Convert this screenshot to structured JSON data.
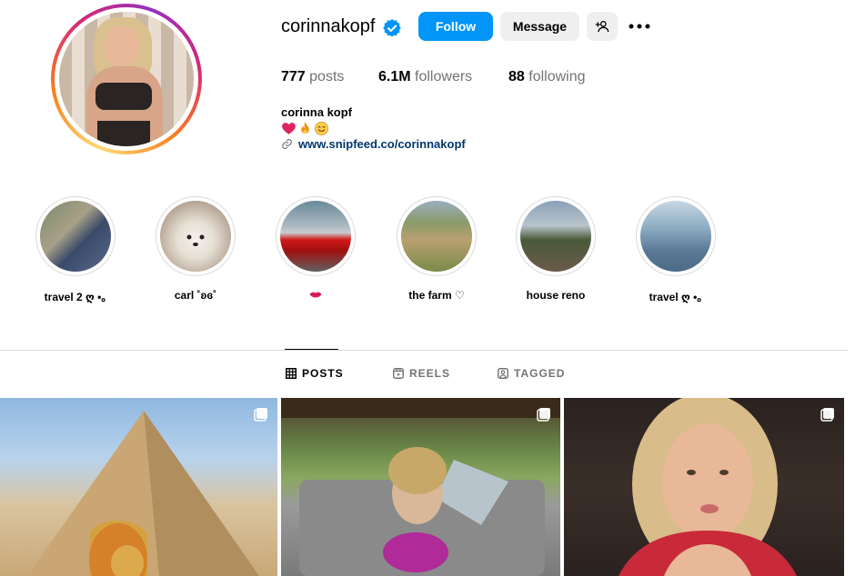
{
  "profile": {
    "username": "corinnakopf",
    "follow_label": "Follow",
    "message_label": "Message"
  },
  "stats": {
    "posts_count": "777",
    "posts_label": "posts",
    "followers_count": "6.1M",
    "followers_label": "followers",
    "following_count": "88",
    "following_label": "following"
  },
  "bio": {
    "name": "corinna kopf",
    "emojis": [
      "red-heart",
      "fire",
      "smiling-face"
    ],
    "link": "www.snipfeed.co/corinnakopf"
  },
  "highlights": [
    {
      "label": "travel 2 ღ •｡"
    },
    {
      "label": "carl ˚ʚɞ˚"
    },
    {
      "label": "lips-emoji"
    },
    {
      "label": "the farm ♡"
    },
    {
      "label": "house reno"
    },
    {
      "label": "travel ღ •｡"
    }
  ],
  "tabs": {
    "posts": "POSTS",
    "reels": "REELS",
    "tagged": "TAGGED"
  },
  "colors": {
    "follow_button": "#0095f6",
    "secondary_button": "#efefef",
    "link": "#00376b",
    "muted_text": "#737373",
    "verified": "#0095f6"
  }
}
